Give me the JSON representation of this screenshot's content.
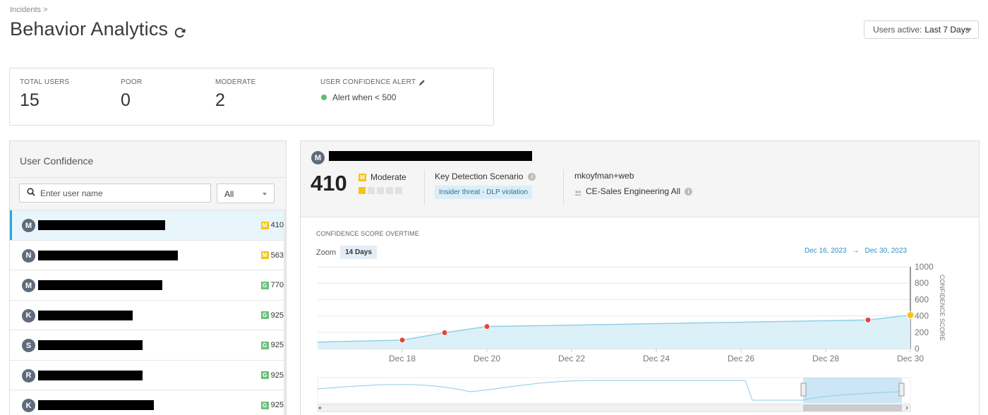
{
  "breadcrumb": "Incidents >",
  "page_title": "Behavior Analytics",
  "users_active": {
    "label": "Users active:",
    "value": "Last 7 Days"
  },
  "stats": {
    "total_users": {
      "label": "TOTAL USERS",
      "value": "15"
    },
    "poor": {
      "label": "POOR",
      "value": "0"
    },
    "moderate": {
      "label": "MODERATE",
      "value": "2"
    },
    "alert": {
      "label": "USER CONFIDENCE ALERT",
      "value": "Alert when < 500"
    }
  },
  "user_confidence": {
    "title": "User Confidence",
    "search_placeholder": "Enter user name",
    "filter_value": "All",
    "users": [
      {
        "initial": "M",
        "badge": "M",
        "score": "410",
        "selected": true
      },
      {
        "initial": "N",
        "badge": "M",
        "score": "563"
      },
      {
        "initial": "M",
        "badge": "G",
        "score": "770"
      },
      {
        "initial": "K",
        "badge": "G",
        "score": "925"
      },
      {
        "initial": "S",
        "badge": "G",
        "score": "925"
      },
      {
        "initial": "R",
        "badge": "G",
        "score": "925"
      },
      {
        "initial": "K",
        "badge": "G",
        "score": "925"
      }
    ]
  },
  "detail": {
    "initial": "M",
    "score": "410",
    "level_badge": "M",
    "level": "Moderate",
    "level_fraction": 0.2,
    "key_detection_label": "Key Detection Scenario",
    "key_detection_tag": "Insider threat - DLP violation",
    "username": "mkoyfman+web",
    "group": "CE-Sales Engineering All"
  },
  "chart": {
    "title": "CONFIDENCE SCORE OVERTIME",
    "zoom_label": "Zoom",
    "zoom_value": "14 Days",
    "range_start": "Dec 16, 2023",
    "range_arrow": "→",
    "range_end": "Dec 30, 2023"
  },
  "colors": {
    "accent": "#29a6d9",
    "moderate": "#f5c518",
    "good": "#6cc07b",
    "point_red": "#e8413c",
    "area": "#d8eef7",
    "line": "#8fd0e8"
  },
  "chart_data": {
    "type": "area",
    "title": "CONFIDENCE SCORE OVERTIME",
    "ylabel": "CONFIDENCE SCORE",
    "xlabel": "",
    "ylim": [
      0,
      1000
    ],
    "y_ticks": [
      "0",
      "200",
      "400",
      "600",
      "800",
      "1000"
    ],
    "x_tick_labels": [
      "Dec 18",
      "Dec 20",
      "Dec 22",
      "Dec 24",
      "Dec 26",
      "Dec 28",
      "Dec 30"
    ],
    "x_tick_days": [
      18,
      20,
      22,
      24,
      26,
      28,
      30
    ],
    "xlim_days": [
      16,
      30
    ],
    "series": [
      {
        "days": [
          16,
          18,
          19,
          20,
          29,
          30
        ],
        "values": [
          80,
          105,
          195,
          270,
          350,
          410
        ],
        "highlight": [
          false,
          true,
          true,
          true,
          true,
          false
        ]
      }
    ]
  }
}
